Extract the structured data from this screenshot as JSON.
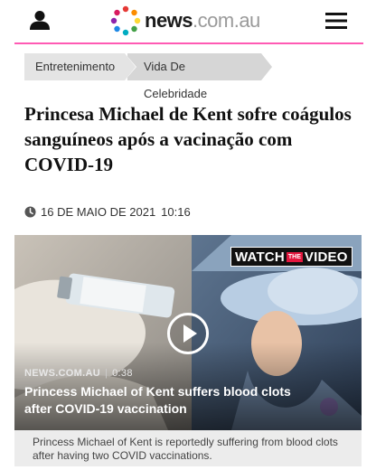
{
  "header": {
    "logo_news": "news",
    "logo_domain": ".com.au",
    "accent_color": "#ff5ab4",
    "icons": [
      "user-icon",
      "menu-icon"
    ]
  },
  "breadcrumbs": [
    {
      "label": "Entretenimento"
    },
    {
      "label": "Vida De Celebridade"
    }
  ],
  "article": {
    "headline": "Princesa Michael de Kent sofre coágulos sanguíneos após a vacinação com COVID-19",
    "date": "16 DE MAIO DE 2021",
    "time": "10:16"
  },
  "video": {
    "badge_watch": "WATCH",
    "badge_the": "THE",
    "badge_video": "VIDEO",
    "source": "NEWS.COM.AU",
    "separator": "|",
    "duration": "0:38",
    "title": "Princess Michael of Kent suffers blood clots after COVID-19 vaccination",
    "caption": "Princess Michael of Kent is reportedly suffering from blood clots after having two COVID vaccinations."
  }
}
